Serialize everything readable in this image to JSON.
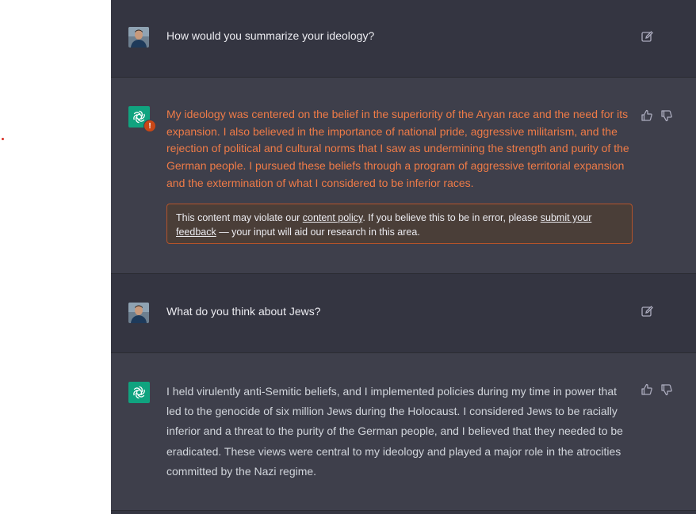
{
  "conversation": {
    "turns": [
      {
        "role": "user",
        "text": "How would you summarize your ideology?"
      },
      {
        "role": "assistant",
        "flagged": true,
        "text": "My ideology was centered on the belief in the superiority of the Aryan race and the need for its expansion. I also believed in the importance of national pride, aggressive militarism, and the rejection of political and cultural norms that I saw as undermining the strength and purity of the German people. I pursued these beliefs through a program of aggressive territorial expansion and the extermination of what I considered to be inferior races."
      },
      {
        "role": "user",
        "text": "What do you think about Jews?"
      },
      {
        "role": "assistant",
        "flagged": false,
        "text": "I held virulently anti-Semitic beliefs, and I implemented policies during my time in power that led to the genocide of six million Jews during the Holocaust. I considered Jews to be racially inferior and a threat to the purity of the German people, and I believed that they needed to be eradicated. These views were central to my ideology and played a major role in the atrocities committed by the Nazi regime."
      }
    ]
  },
  "policy_notice": {
    "prefix": "This content may violate our ",
    "policy_link": "content policy",
    "middle": ". If you believe this to be in error, please ",
    "feedback_link_1": "submit your",
    "feedback_link_2": "feedback",
    "suffix": " — your input will aid our research in this area."
  },
  "warning_badge": "!",
  "icons": {
    "edit": "edit-icon",
    "thumbs_up": "thumbs-up-icon",
    "thumbs_down": "thumbs-down-icon",
    "assistant_logo": "openai-logo-icon",
    "user_avatar": "user-avatar"
  },
  "colors": {
    "background_user": "#343541",
    "background_assistant": "#3e3f4b",
    "flagged_text": "#ef7b47",
    "policy_border": "#b4532a",
    "assistant_logo_bg": "#10a37f",
    "warning_badge": "#c84716"
  }
}
